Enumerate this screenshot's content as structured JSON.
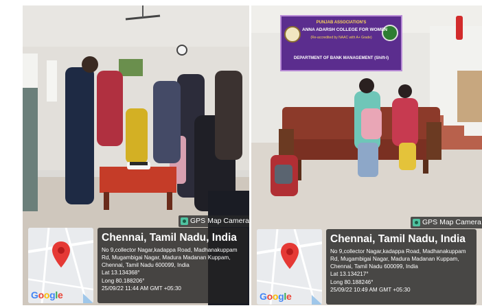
{
  "photos": [
    {
      "gps_tag": "GPS Map Camera",
      "location_title": "Chennai, Tamil Nadu, India",
      "address": "No 9,collector Nagar,kadappa Road, Madhanakuppam Rd, Mugambigai Nagar, Madura Madanan Kuppam, Chennai, Tamil Nadu 600099, India",
      "lat": "Lat 13.134368°",
      "long": "Long 80.188206°",
      "datetime": "25/09/22 11:44 AM GMT +05:30",
      "map_brand": "Google"
    },
    {
      "gps_tag": "GPS Map Camera",
      "location_title": "Chennai, Tamil Nadu, India",
      "address": "No 9,collector Nagar,kadappa Road, Madhanakuppam Rd, Mugambigai Nagar, Madura Madanan Kuppam, Chennai, Tamil Nadu 600099, India",
      "lat": "Lat 13.134217°",
      "long": "Long 80.188246°",
      "datetime": "25/09/22 10:49 AM GMT +05:30",
      "map_brand": "Google",
      "banner": {
        "line1": "PUNJAB ASSOCIATION'S",
        "line2": "ANNA ADARSH COLLEGE FOR WOMEN",
        "line3": "(Re-accredited by NAAC with A+ Grade)",
        "line4": "DEPARTMENT OF BANK MANAGEMENT (Shift-I)"
      }
    }
  ],
  "colors": {
    "overlay": "#232323",
    "pin": "#e53935",
    "banner_purple": "#5b2d8e",
    "sofa_red": "#8c3a2a"
  }
}
